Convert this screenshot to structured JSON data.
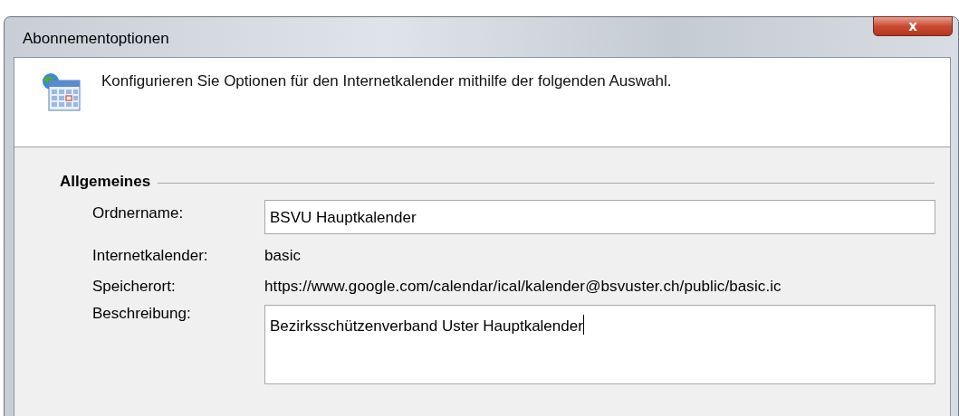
{
  "window": {
    "title": "Abonnementoptionen",
    "close": "x"
  },
  "header": {
    "text": "Konfigurieren Sie Optionen für den Internetkalender mithilfe der folgenden Auswahl."
  },
  "section": {
    "title": "Allgemeines"
  },
  "fields": [
    {
      "kind": "input",
      "label": "Ordnername:",
      "value": "BSVU Hauptkalender"
    },
    {
      "kind": "text",
      "label": "Internetkalender:",
      "value": "basic"
    },
    {
      "kind": "text",
      "label": "Speicherort:",
      "value": "https://www.google.com/calendar/ical/kalender@bsvuster.ch/public/basic.ic"
    },
    {
      "kind": "textarea",
      "label": "Beschreibung:",
      "value": "Bezirksschützenverband Uster Hauptkalender"
    }
  ]
}
